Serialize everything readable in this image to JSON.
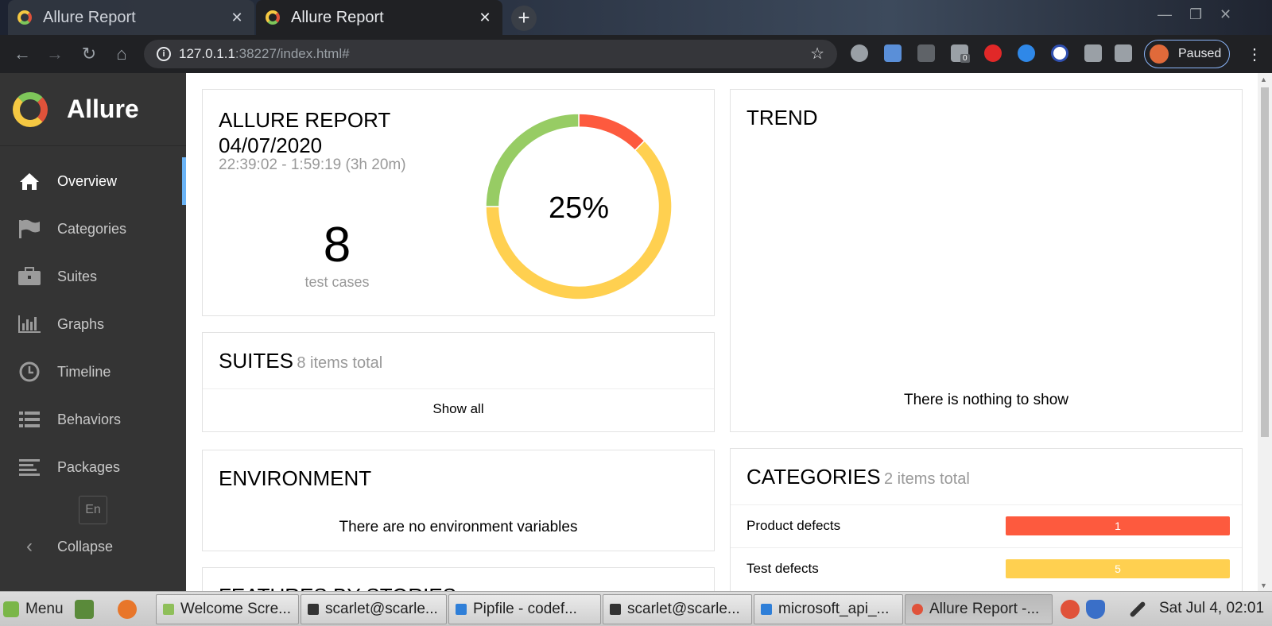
{
  "browser": {
    "tabs": [
      {
        "label": "Allure Report",
        "active": false
      },
      {
        "label": "Allure Report",
        "active": true
      }
    ],
    "url_host": "127.0.1.1",
    "url_rest": ":38227/index.html#",
    "extensions_badge": "0",
    "profile_label": "Paused"
  },
  "sidebar": {
    "brand": "Allure",
    "items": [
      {
        "label": "Overview",
        "icon": "home-icon",
        "active": true
      },
      {
        "label": "Categories",
        "icon": "flag-icon",
        "active": false
      },
      {
        "label": "Suites",
        "icon": "briefcase-icon",
        "active": false
      },
      {
        "label": "Graphs",
        "icon": "bar-chart-icon",
        "active": false
      },
      {
        "label": "Timeline",
        "icon": "clock-icon",
        "active": false
      },
      {
        "label": "Behaviors",
        "icon": "list-icon",
        "active": false
      },
      {
        "label": "Packages",
        "icon": "align-left-icon",
        "active": false
      }
    ],
    "language": "En",
    "collapse_label": "Collapse"
  },
  "summary": {
    "title_line1": "ALLURE REPORT",
    "title_line2": "04/07/2020",
    "time_range": "22:39:02 - 1:59:19 (3h 20m)",
    "count": "8",
    "count_label": "test cases",
    "percent": "25%",
    "donut": [
      {
        "status": "failed",
        "value": 1,
        "color": "#fd5a3e"
      },
      {
        "status": "broken",
        "value": 5,
        "color": "#ffd050"
      },
      {
        "status": "passed",
        "value": 2,
        "color": "#97cc64"
      }
    ]
  },
  "trend": {
    "title": "TREND",
    "empty_message": "There is nothing to show"
  },
  "suites": {
    "title": "SUITES",
    "subtitle": "8 items total",
    "show_all": "Show all"
  },
  "environment": {
    "title": "ENVIRONMENT",
    "empty_message": "There are no environment variables"
  },
  "features": {
    "title": "FEATURES BY STORIES"
  },
  "categories": {
    "title": "CATEGORIES",
    "subtitle": "2 items total",
    "rows": [
      {
        "name": "Product defects",
        "value": "1",
        "color": "#fd5a3e"
      },
      {
        "name": "Test defects",
        "value": "5",
        "color": "#ffd050"
      }
    ]
  },
  "taskbar": {
    "menu_label": "Menu",
    "windows": [
      {
        "label": "Welcome Scre...",
        "active": false
      },
      {
        "label": "scarlet@scarle...",
        "active": false
      },
      {
        "label": "Pipfile - codef...",
        "active": false
      },
      {
        "label": "scarlet@scarle...",
        "active": false
      },
      {
        "label": "microsoft_api_...",
        "active": false
      },
      {
        "label": "Allure Report -...",
        "active": true
      }
    ],
    "clock": "Sat Jul  4, 02:01"
  }
}
